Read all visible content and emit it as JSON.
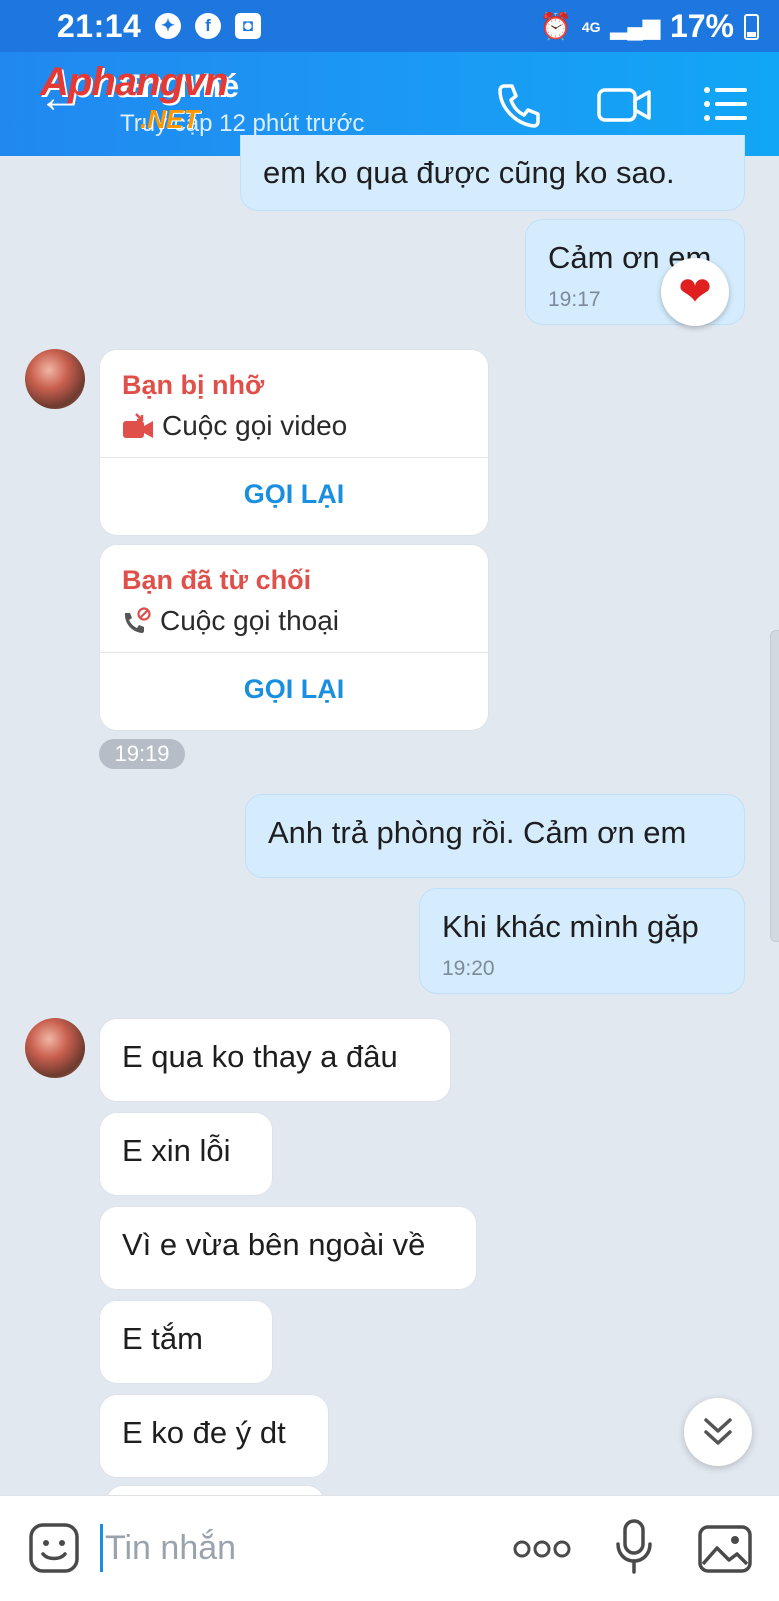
{
  "status_bar": {
    "time": "21:14",
    "network": "4G",
    "battery": "17%"
  },
  "header": {
    "contact_name": "Em Nhé",
    "last_seen": "Truy cập 12 phút trước",
    "watermark": "Aphangvn",
    "watermark_suffix": ".NET"
  },
  "messages": {
    "m1": {
      "text": "em ko qua được cũng ko sao."
    },
    "m2": {
      "text": "Cảm ơn em",
      "time": "19:17",
      "reaction": "heart"
    },
    "call1": {
      "status": "Bạn bị nhỡ",
      "type": "Cuộc gọi video",
      "action": "GỌI LẠI"
    },
    "call2": {
      "status": "Bạn đã từ chối",
      "type": "Cuộc gọi thoại",
      "action": "GỌI LẠI"
    },
    "time_chip": "19:19",
    "m3": {
      "text": "Anh trả phòng rồi. Cảm ơn em"
    },
    "m4": {
      "text": "Khi khác mình gặp",
      "time": "19:20"
    },
    "m5": {
      "text": "E qua ko thay a đâu"
    },
    "m6": {
      "text": "E xin lỗi"
    },
    "m7": {
      "text": "Vì e vừa bên ngoài về"
    },
    "m8": {
      "text": "E tắm"
    },
    "m9": {
      "text": "E ko đe ý dt"
    }
  },
  "input_bar": {
    "placeholder": "Tin nhắn"
  },
  "colors": {
    "header": "#1a9bf4",
    "mine_bubble": "#d4ecfd",
    "missed": "#e0504a",
    "action": "#1a8fe0"
  }
}
